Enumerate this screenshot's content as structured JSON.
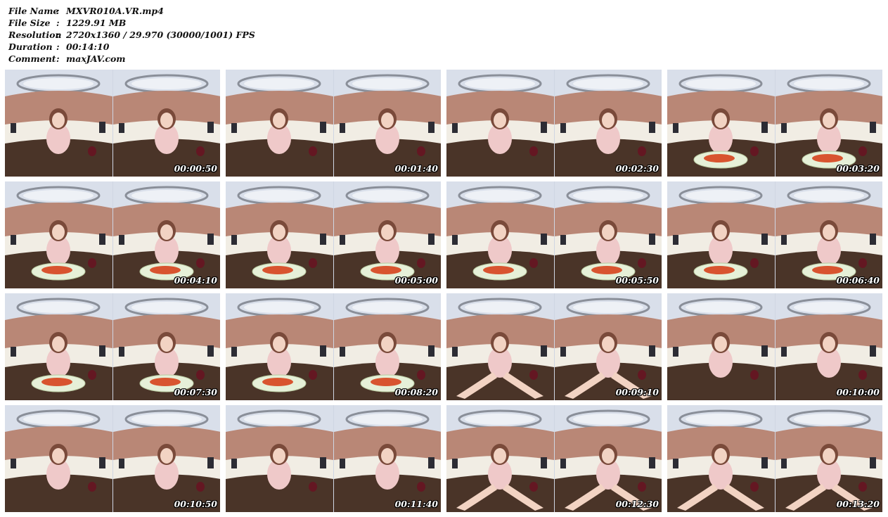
{
  "info": [
    {
      "label": "File Name",
      "value": "MXVR010A.VR.mp4"
    },
    {
      "label": "File Size",
      "value": "1229.91 MB"
    },
    {
      "label": "Resolution",
      "value": "2720x1360 / 29.970 (30000/1001) FPS"
    },
    {
      "label": "Duration",
      "value": "00:14:10"
    },
    {
      "label": "Comment",
      "value": "maxJAV.com"
    }
  ],
  "separator": ":",
  "thumbnails": [
    {
      "timestamp": "00:00:50",
      "plate": false,
      "hands": false
    },
    {
      "timestamp": "00:01:40",
      "plate": false,
      "hands": false
    },
    {
      "timestamp": "00:02:30",
      "plate": false,
      "hands": false
    },
    {
      "timestamp": "00:03:20",
      "plate": true,
      "hands": false
    },
    {
      "timestamp": "00:04:10",
      "plate": true,
      "hands": false
    },
    {
      "timestamp": "00:05:00",
      "plate": true,
      "hands": false
    },
    {
      "timestamp": "00:05:50",
      "plate": true,
      "hands": false
    },
    {
      "timestamp": "00:06:40",
      "plate": true,
      "hands": false
    },
    {
      "timestamp": "00:07:30",
      "plate": true,
      "hands": false
    },
    {
      "timestamp": "00:08:20",
      "plate": true,
      "hands": false
    },
    {
      "timestamp": "00:09:10",
      "plate": false,
      "hands": true
    },
    {
      "timestamp": "00:10:00",
      "plate": false,
      "hands": false
    },
    {
      "timestamp": "00:10:50",
      "plate": false,
      "hands": false
    },
    {
      "timestamp": "00:11:40",
      "plate": false,
      "hands": false
    },
    {
      "timestamp": "00:12:30",
      "plate": false,
      "hands": true
    },
    {
      "timestamp": "00:13:20",
      "plate": false,
      "hands": true
    }
  ],
  "colors": {
    "ceiling": "#d9dfea",
    "wall": "#b98776",
    "sofa": "#f1ede4",
    "table": "#4a3428",
    "skin": "#f2d3c3",
    "hair": "#7a4a3a",
    "dress": "#efc9c9",
    "plate": "#e6f0d8",
    "food": "#d8542f",
    "timestamp": "#ffffff"
  }
}
